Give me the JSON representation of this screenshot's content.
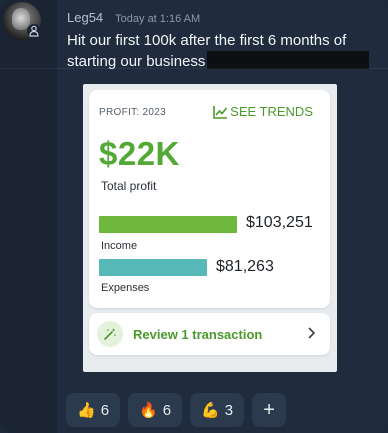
{
  "message": {
    "author": "Leg54",
    "timestamp": "Today at 1:16 AM",
    "text": "Hit our first 100k after the first 6 months of starting our business",
    "avatar_icon": "user-avatar",
    "role_icon": "person-icon"
  },
  "attachment": {
    "card_label": "PROFIT: 2023",
    "trends_label": "SEE TRENDS",
    "trends_icon": "trend-chart-icon",
    "total_value": "$22K",
    "total_label": "Total profit",
    "income": {
      "value": "$103,251",
      "label": "Income",
      "color": "#6cb73c"
    },
    "expenses": {
      "value": "$81,263",
      "label": "Expenses",
      "color": "#56b9b8"
    },
    "review_label": "Review 1 transaction",
    "review_icon": "magic-wand-icon",
    "accent": "#53a935"
  },
  "reactions": [
    {
      "emoji": "👍",
      "count": "6",
      "icon": "thumbs-up-icon"
    },
    {
      "emoji": "🔥",
      "count": "6",
      "icon": "fire-icon"
    },
    {
      "emoji": "💪",
      "count": "3",
      "icon": "flexed-biceps-icon"
    }
  ],
  "add_reaction": "+"
}
